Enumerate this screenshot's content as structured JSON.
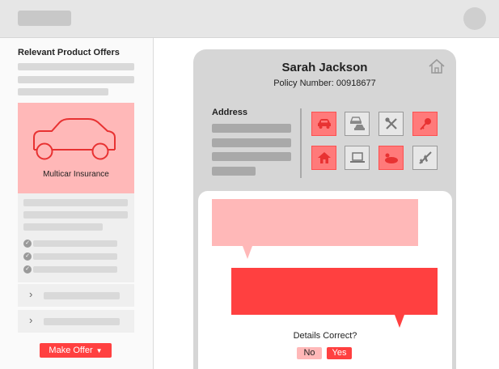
{
  "header": {
    "logo_icon": "logo-placeholder",
    "avatar_icon": "user-avatar"
  },
  "sidebar": {
    "title": "Relevant Product Offers",
    "offer": {
      "label": "Multicar Insurance",
      "icon": "car-icon"
    },
    "feature_checks": 3,
    "accordion_items": 2,
    "make_offer_label": "Make Offer"
  },
  "customer": {
    "name": "Sarah Jackson",
    "policy": "Policy Number: 00918677",
    "address_label": "Address"
  },
  "products": [
    {
      "icon": "car-icon",
      "active": true
    },
    {
      "icon": "multi-car-icon",
      "active": false
    },
    {
      "icon": "tools-icon",
      "active": false
    },
    {
      "icon": "key-icon",
      "active": true
    },
    {
      "icon": "house-icon",
      "active": true
    },
    {
      "icon": "laptop-icon",
      "active": false
    },
    {
      "icon": "pet-icon",
      "active": true
    },
    {
      "icon": "plane-icon",
      "active": false
    }
  ],
  "dialog": {
    "question": "Details Correct?",
    "no_label": "No",
    "yes_label": "Yes"
  },
  "colors": {
    "accent": "#ff4040",
    "accent_light": "#ffb8b8",
    "icon_active": "#ff7a7a",
    "panel_gray": "#d6d6d6"
  }
}
